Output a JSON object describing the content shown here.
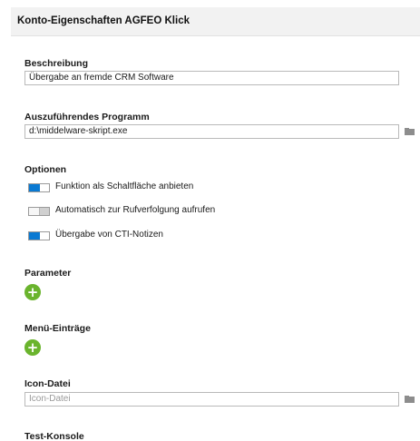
{
  "header": {
    "title": "Konto-Eigenschaften AGFEO Klick"
  },
  "beschreibung": {
    "label": "Beschreibung",
    "value": "Übergabe an fremde CRM Software"
  },
  "programm": {
    "label": "Auszuführendes Programm",
    "value": "d:\\middelware-skript.exe"
  },
  "optionen": {
    "label": "Optionen",
    "items": [
      {
        "label": "Funktion als Schaltfläche anbieten",
        "enabled": true
      },
      {
        "label": "Automatisch zur Rufverfolgung aufrufen",
        "enabled": false
      },
      {
        "label": "Übergabe von CTI-Notizen",
        "enabled": true
      }
    ]
  },
  "parameter": {
    "label": "Parameter",
    "add_symbol": "+"
  },
  "menu_eintraege": {
    "label": "Menü-Einträge",
    "add_symbol": "+"
  },
  "icon_datei": {
    "label": "Icon-Datei",
    "placeholder": "Icon-Datei",
    "value": ""
  },
  "test_konsole": {
    "label": "Test-Konsole"
  },
  "colors": {
    "accent": "#0a79d2",
    "add_button": "#6ab42d",
    "header_bg": "#f2f2f2"
  }
}
